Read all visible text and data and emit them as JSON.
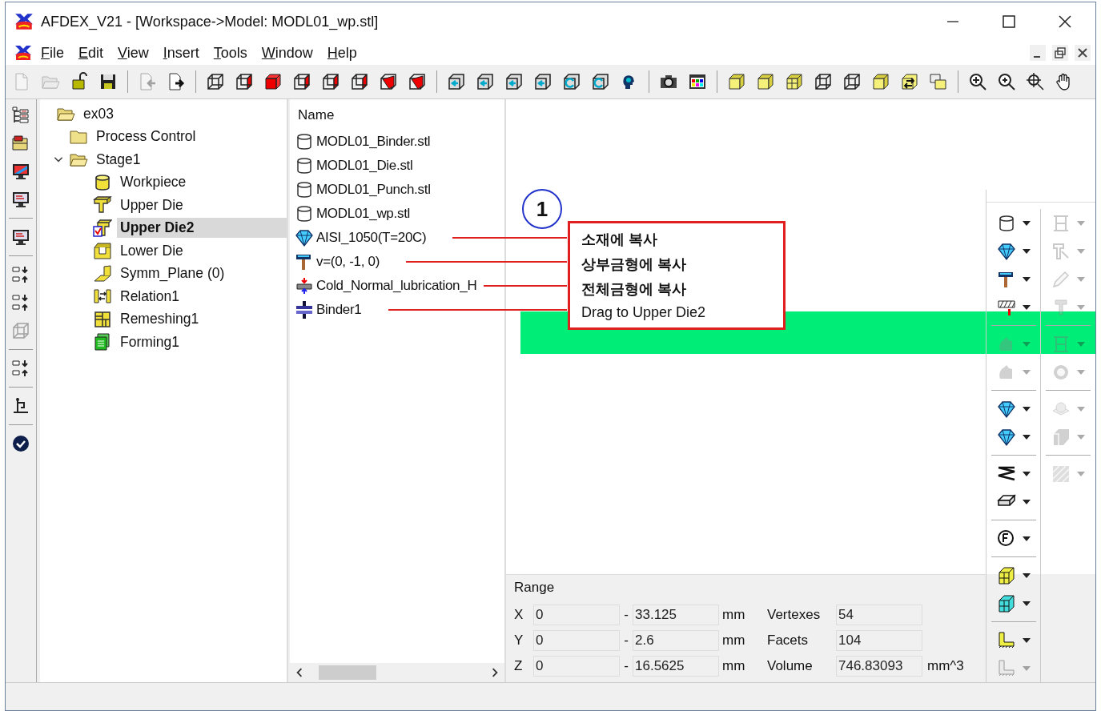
{
  "window": {
    "title": "AFDEX_V21 - [Workspace->Model: MODL01_wp.stl]"
  },
  "menu": [
    {
      "label": "File"
    },
    {
      "label": "Edit"
    },
    {
      "label": "View"
    },
    {
      "label": "Insert"
    },
    {
      "label": "Tools"
    },
    {
      "label": "Window"
    },
    {
      "label": "Help"
    }
  ],
  "toolbar": [
    [
      {
        "kind": "doc",
        "disabled": true
      },
      {
        "kind": "folder-open",
        "disabled": true
      },
      {
        "kind": "lock",
        "disabled": false
      },
      {
        "kind": "save",
        "disabled": false
      }
    ],
    [
      {
        "kind": "import",
        "disabled": true
      },
      {
        "kind": "export",
        "disabled": false
      }
    ],
    [
      {
        "kind": "cube-wire",
        "disabled": false
      },
      {
        "kind": "cube-red",
        "disabled": false
      },
      {
        "kind": "cube-solid-red",
        "disabled": false
      },
      {
        "kind": "cube-red",
        "disabled": false
      },
      {
        "kind": "cube-red",
        "disabled": false
      },
      {
        "kind": "cube-red",
        "disabled": false
      },
      {
        "kind": "cube-cut",
        "disabled": false
      },
      {
        "kind": "cube-cut",
        "disabled": false
      }
    ],
    [
      {
        "kind": "cube-arrow",
        "disabled": false
      },
      {
        "kind": "cube-arrow",
        "disabled": false
      },
      {
        "kind": "cube-arrow",
        "disabled": false
      },
      {
        "kind": "cube-arrow",
        "disabled": false
      },
      {
        "kind": "cube-rotate",
        "disabled": false
      },
      {
        "kind": "cube-rotate",
        "disabled": false
      },
      {
        "kind": "head",
        "disabled": false
      }
    ],
    [
      {
        "kind": "camera",
        "disabled": false
      },
      {
        "kind": "palette",
        "disabled": false
      }
    ],
    [
      {
        "kind": "cube-yellow",
        "disabled": false
      },
      {
        "kind": "cube-yellow",
        "disabled": false
      },
      {
        "kind": "cube-grid",
        "disabled": false
      },
      {
        "kind": "cube-wire",
        "disabled": false
      },
      {
        "kind": "cube-wire",
        "disabled": false
      },
      {
        "kind": "cube-yellow",
        "disabled": false
      },
      {
        "kind": "cube-swap",
        "disabled": false
      },
      {
        "kind": "cube-stack",
        "disabled": false
      }
    ],
    [
      {
        "kind": "zoom-window",
        "disabled": false
      },
      {
        "kind": "zoom-in",
        "disabled": false
      },
      {
        "kind": "zoom-fit",
        "disabled": false
      },
      {
        "kind": "hand",
        "disabled": false
      }
    ]
  ],
  "side_toolbar": [
    [
      {
        "kind": "tree",
        "disabled": false
      },
      {
        "kind": "folder-stack",
        "disabled": false
      },
      {
        "kind": "monitor-color",
        "disabled": false
      },
      {
        "kind": "monitor",
        "disabled": false
      }
    ],
    [
      {
        "kind": "monitor",
        "disabled": false
      }
    ],
    [
      {
        "kind": "align",
        "disabled": false
      },
      {
        "kind": "align",
        "disabled": false
      },
      {
        "kind": "cube-wire",
        "disabled": true
      }
    ],
    [
      {
        "kind": "align",
        "disabled": false
      }
    ],
    [
      {
        "kind": "stand",
        "disabled": false
      }
    ],
    [
      {
        "kind": "check-circle",
        "disabled": false
      }
    ]
  ],
  "tree": [
    {
      "label": "ex03",
      "kind": "folder-open",
      "selected": false,
      "children": [
        {
          "label": "Process Control",
          "kind": "folder",
          "selected": false
        },
        {
          "label": "Stage1",
          "kind": "folder-open",
          "selected": false,
          "expanded": true,
          "children": [
            {
              "label": "Workpiece",
              "kind": "cylinder-yellow",
              "selected": false
            },
            {
              "label": "Upper Die",
              "kind": "die",
              "selected": false
            },
            {
              "label": "Upper Die2",
              "kind": "die-checked",
              "selected": true
            },
            {
              "label": "Lower Die",
              "kind": "lower-die",
              "selected": false
            },
            {
              "label": "Symm_Plane (0)",
              "kind": "plane",
              "selected": false
            },
            {
              "label": "Relation1",
              "kind": "relation",
              "selected": false
            },
            {
              "label": "Remeshing1",
              "kind": "remesh",
              "selected": false
            },
            {
              "label": "Forming1",
              "kind": "forming",
              "selected": false
            }
          ]
        }
      ]
    }
  ],
  "list": {
    "column": "Name",
    "items": [
      {
        "label": "MODL01_Binder.stl",
        "kind": "cylinder",
        "leader": false
      },
      {
        "label": "MODL01_Die.stl",
        "kind": "cylinder",
        "leader": false
      },
      {
        "label": "MODL01_Punch.stl",
        "kind": "cylinder",
        "leader": false
      },
      {
        "label": "MODL01_wp.stl",
        "kind": "cylinder",
        "leader": false
      },
      {
        "label": "AISI_1050(T=20C)",
        "kind": "gem",
        "leader": true
      },
      {
        "label": "v=(0, -1, 0)",
        "kind": "hammer",
        "leader": true
      },
      {
        "label": "Cold_Normal_lubrication_H",
        "kind": "lubricant",
        "leader": true
      },
      {
        "label": "Binder1",
        "kind": "binder",
        "leader": true
      }
    ]
  },
  "callout": {
    "number": "1",
    "lines": [
      {
        "text": "소재에 복사",
        "bold": true
      },
      {
        "text": "상부금형에 복사",
        "bold": true
      },
      {
        "text": "전체금형에 복사",
        "bold": true
      },
      {
        "text": "Drag to Upper Die2",
        "bold": false
      }
    ]
  },
  "range": {
    "title": "Range",
    "rows": [
      {
        "axis": "X",
        "min": "0",
        "separator": "-",
        "max": "33.125",
        "unit": "mm",
        "stat_label": "Vertexes",
        "stat_value": "54"
      },
      {
        "axis": "Y",
        "min": "0",
        "separator": "-",
        "max": "2.6",
        "unit": "mm",
        "stat_label": "Facets",
        "stat_value": "104"
      },
      {
        "axis": "Z",
        "min": "0",
        "separator": "-",
        "max": "16.5625",
        "unit": "mm",
        "stat_label": "Volume",
        "stat_value": "746.83093",
        "stat_unit": "mm^3"
      }
    ]
  },
  "tool_panel": {
    "columns": [
      [
        [
          {
            "kind": "cylinder",
            "disabled": false
          },
          {
            "kind": "gem",
            "disabled": false
          },
          {
            "kind": "hammer",
            "disabled": false
          },
          {
            "kind": "hatch",
            "disabled": false
          }
        ],
        [
          {
            "kind": "blob",
            "disabled": true
          },
          {
            "kind": "blob",
            "disabled": true
          }
        ],
        [
          {
            "kind": "gem",
            "disabled": false
          },
          {
            "kind": "gem",
            "disabled": false
          }
        ],
        [
          {
            "kind": "spring",
            "disabled": false
          },
          {
            "kind": "plate",
            "disabled": false
          }
        ],
        [
          {
            "kind": "circle",
            "disabled": false
          }
        ],
        [
          {
            "kind": "grid-yellow",
            "disabled": false
          },
          {
            "kind": "grid-cyan",
            "disabled": false
          }
        ],
        [
          {
            "kind": "step",
            "disabled": false
          },
          {
            "kind": "step",
            "disabled": true
          }
        ]
      ],
      [
        [
          {
            "kind": "frame",
            "disabled": true
          },
          {
            "kind": "press",
            "disabled": true
          },
          {
            "kind": "pencil",
            "disabled": true
          },
          {
            "kind": "pin",
            "disabled": true
          }
        ],
        [
          {
            "kind": "frame",
            "disabled": true
          },
          {
            "kind": "ring",
            "disabled": true
          }
        ],
        [
          {
            "kind": "sphere",
            "disabled": true
          },
          {
            "kind": "flag",
            "disabled": true
          }
        ],
        [
          {
            "kind": "stripes",
            "disabled": true
          }
        ]
      ]
    ]
  }
}
